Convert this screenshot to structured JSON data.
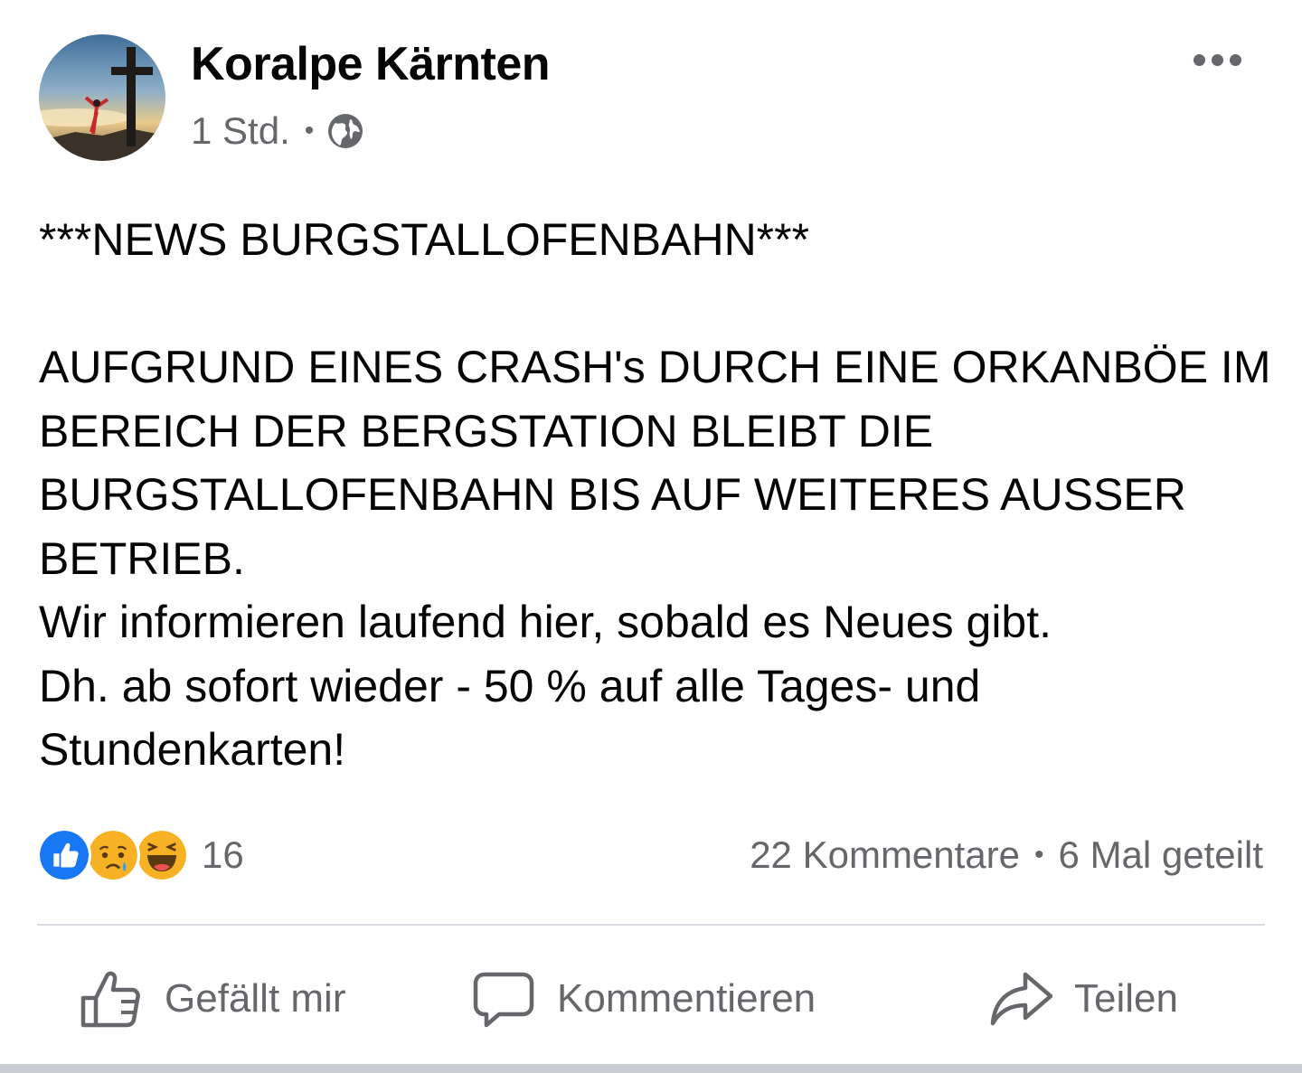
{
  "post": {
    "page_name": "Koralpe Kärnten",
    "timestamp": "1 Std.",
    "separator": "•",
    "audience_icon": "globe-icon",
    "more_icon": "more-options-icon",
    "text": "***NEWS BURGSTALLOFENBAHN***\n\nAUFGRUND EINES CRASH's DURCH EINE ORKANBÖE IM BEREICH DER BERGSTATION BLEIBT DIE BURGSTALLOFENBAHN BIS AUF WEITERES AUSSER BETRIEB.\nWir informieren laufend hier, sobald es Neues gibt.\nDh. ab sofort wieder - 50 % auf alle Tages- und Stundenkarten!"
  },
  "engagement": {
    "reactions": [
      "like",
      "sad",
      "haha"
    ],
    "reaction_count": "16",
    "comments": "22 Kommentare",
    "separator": "•",
    "shares": "6 Mal geteilt"
  },
  "actions": {
    "like_label": "Gefällt mir",
    "comment_label": "Kommentieren",
    "share_label": "Teilen"
  },
  "colors": {
    "text_primary": "#050505",
    "text_secondary": "#65676b",
    "like_blue": "#1877f2",
    "divider": "#dadde1"
  }
}
